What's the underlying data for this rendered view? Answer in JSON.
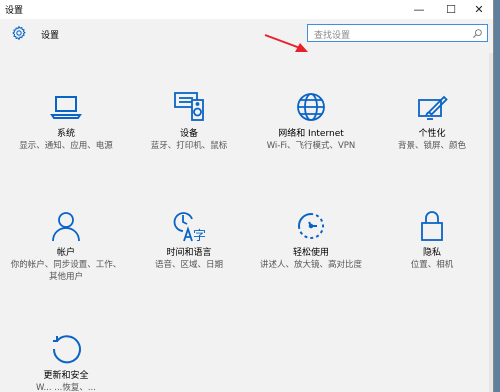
{
  "window": {
    "title": "设置",
    "minimize_glyph": "—",
    "maximize_glyph": "☐",
    "close_glyph": "✕"
  },
  "header": {
    "app_name": "设置",
    "search_placeholder": "查找设置"
  },
  "colors": {
    "accent": "#0a64c6",
    "arrow": "#e8202a",
    "search_border": "#3f8ee0"
  },
  "tiles": [
    {
      "icon": "laptop-icon",
      "name": "系统",
      "desc": "显示、通知、应用、电源"
    },
    {
      "icon": "devices-icon",
      "name": "设备",
      "desc": "蓝牙、打印机、鼠标"
    },
    {
      "icon": "globe-icon",
      "name": "网络和 Internet",
      "desc": "Wi-Fi、飞行模式、VPN"
    },
    {
      "icon": "personalization-icon",
      "name": "个性化",
      "desc": "背景、锁屏、颜色"
    },
    {
      "icon": "person-icon",
      "name": "帐户",
      "desc": "你的帐户、同步设置、工作、其他用户"
    },
    {
      "icon": "time-language-icon",
      "name": "时间和语言",
      "desc": "语音、区域、日期"
    },
    {
      "icon": "ease-of-access-icon",
      "name": "轻松使用",
      "desc": "讲述人、放大镜、高对比度"
    },
    {
      "icon": "lock-icon",
      "name": "隐私",
      "desc": "位置、相机"
    },
    {
      "icon": "update-icon",
      "name": "更新和安全",
      "desc": "W... ...恢复、..."
    }
  ]
}
